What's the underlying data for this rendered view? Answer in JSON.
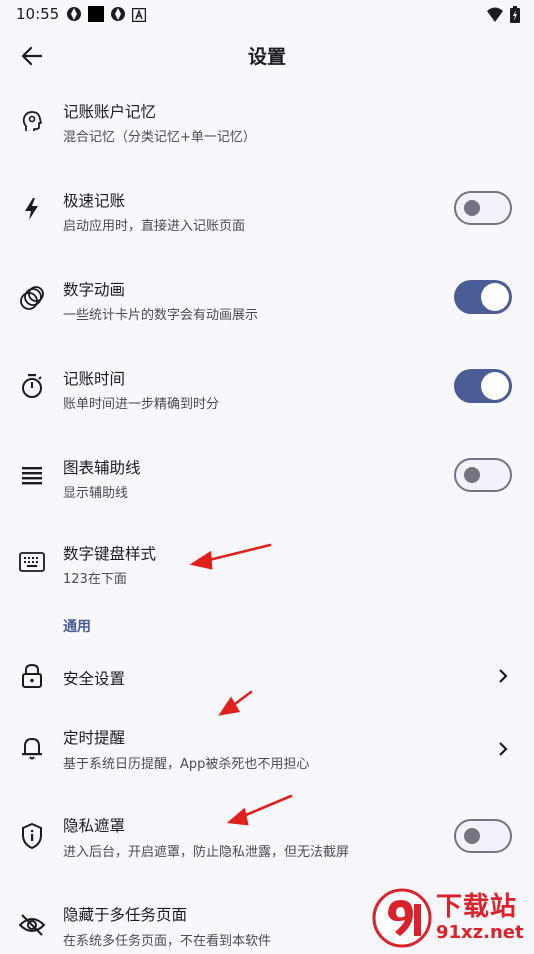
{
  "status_bar": {
    "time": "10:55"
  },
  "header": {
    "title": "设置"
  },
  "rows": [
    {
      "title": "记账账户记忆",
      "subtitle": "混合记忆（分类记忆+单一记忆）"
    },
    {
      "title": "极速记账",
      "subtitle": "启动应用时，直接进入记账页面",
      "switch_on": false
    },
    {
      "title": "数字动画",
      "subtitle": "一些统计卡片的数字会有动画展示",
      "switch_on": true
    },
    {
      "title": "记账时间",
      "subtitle": "账单时间进一步精确到时分",
      "switch_on": true
    },
    {
      "title": "图表辅助线",
      "subtitle": "显示辅助线",
      "switch_on": false
    },
    {
      "title": "数字键盘样式",
      "subtitle": "123在下面"
    }
  ],
  "section": {
    "label": "通用"
  },
  "general_rows": [
    {
      "title": "安全设置"
    },
    {
      "title": "定时提醒",
      "subtitle": "基于系统日历提醒，App被杀死也不用担心"
    },
    {
      "title": "隐私遮罩",
      "subtitle": "进入后台，开启遮罩，防止隐私泄露，但无法截屏",
      "switch_on": false
    },
    {
      "title": "隐藏于多任务页面",
      "subtitle": "在系统多任务页面，不在看到本软件"
    }
  ],
  "watermark": {
    "brand": "下载站",
    "site": "91xz.net"
  },
  "colors": {
    "accent": "#4a5d94",
    "annotation_arrow": "#e0201c",
    "background": "#f8f7fc"
  }
}
